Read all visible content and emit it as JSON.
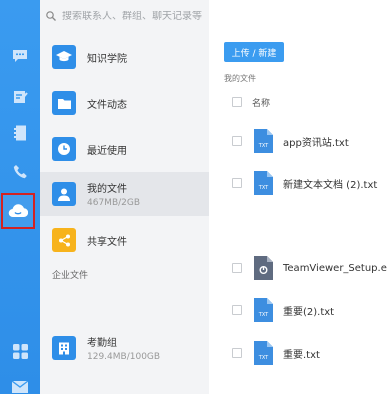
{
  "search": {
    "placeholder": "搜索联系人、群组、聊天记录等"
  },
  "sidebar": {
    "items": [
      {
        "label": "知识学院",
        "sub": ""
      },
      {
        "label": "文件动态",
        "sub": ""
      },
      {
        "label": "最近使用",
        "sub": ""
      },
      {
        "label": "我的文件",
        "sub": "467MB/2GB"
      },
      {
        "label": "共享文件",
        "sub": ""
      }
    ],
    "enterprise_section": "企业文件",
    "enterprise_items": [
      {
        "label": "考勤组",
        "sub": "129.4MB/100GB"
      }
    ]
  },
  "main": {
    "upload_label": "上传 / 新建",
    "breadcrumb": "我的文件",
    "column_name": "名称",
    "files": [
      {
        "name": "app资讯站.txt",
        "type": "TXT"
      },
      {
        "name": "新建文本文档 (2).txt",
        "type": "TXT"
      },
      {
        "name": "TeamViewer_Setup.exe",
        "type": ""
      },
      {
        "name": "重要(2).txt",
        "type": "TXT"
      },
      {
        "name": "重要.txt",
        "type": "TXT"
      }
    ]
  },
  "colors": {
    "rail": "#3a9bf0",
    "accent": "#3b9cf0",
    "shared_icon": "#f7b31c",
    "highlight_outline": "#d32222"
  },
  "icons": {
    "rail": [
      "chat-icon",
      "approval-icon",
      "contacts-icon",
      "phone-icon",
      "cloud-drive-icon",
      "apps-icon",
      "mail-icon"
    ]
  }
}
